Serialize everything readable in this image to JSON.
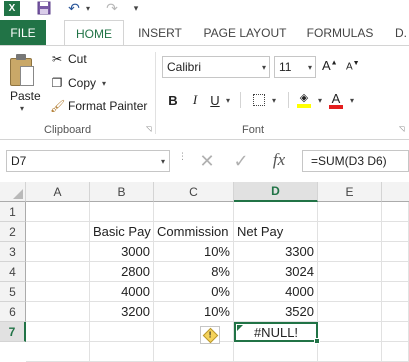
{
  "quick_access": {
    "app_icon": "excel-logo-icon",
    "app_letter": "X",
    "save_icon": "save-icon",
    "undo_icon": "undo-icon",
    "redo_icon": "redo-icon"
  },
  "tabs": {
    "file": "FILE",
    "home": "HOME",
    "insert": "INSERT",
    "page_layout": "PAGE LAYOUT",
    "formulas": "FORMULAS",
    "data": "D."
  },
  "clipboard": {
    "paste_label": "Paste",
    "cut_label": "Cut",
    "copy_label": "Copy",
    "format_painter_label": "Format Painter",
    "group_label": "Clipboard"
  },
  "font": {
    "font_name": "Calibri",
    "font_size": "11",
    "bold_label": "B",
    "italic_label": "I",
    "underline_label": "U",
    "font_color_label": "A",
    "grow_label": "A",
    "shrink_label": "A",
    "group_label": "Font",
    "fill_color": "#ffff00",
    "font_color": "#e41e1e"
  },
  "formula_bar": {
    "name_box": "D7",
    "formula": "=SUM(D3 D6)",
    "fx_label": "fx"
  },
  "sheet": {
    "accent_color": "#217346",
    "columns": [
      "A",
      "B",
      "C",
      "D",
      "E"
    ],
    "selected_column": "D",
    "rows": [
      "1",
      "2",
      "3",
      "4",
      "5",
      "6",
      "7"
    ],
    "selected_row": "7",
    "headers": {
      "b": "Basic Pay",
      "c": "Commission",
      "d": "Net Pay"
    },
    "data_rows": [
      {
        "b": "3000",
        "c": "10%",
        "d": "3300"
      },
      {
        "b": "2800",
        "c": "8%",
        "d": "3024"
      },
      {
        "b": "4000",
        "c": "0%",
        "d": "4000"
      },
      {
        "b": "3200",
        "c": "10%",
        "d": "3520"
      }
    ],
    "active_cell_value": "#NULL!",
    "warning_symbol": "!"
  }
}
